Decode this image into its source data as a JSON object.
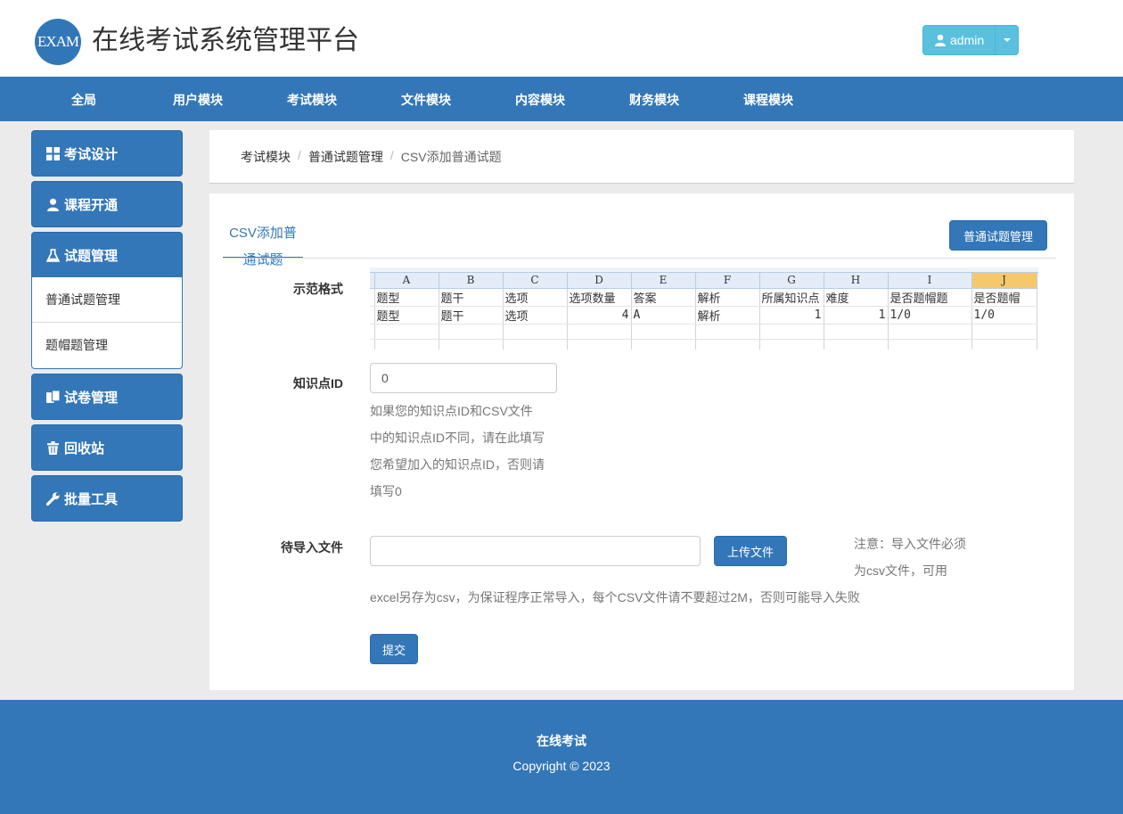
{
  "header": {
    "logo_text": "EXAM",
    "title": "在线考试系统管理平台",
    "user_label": "admin",
    "accent": "#3377b8"
  },
  "nav": {
    "items": [
      "全局",
      "用户模块",
      "考试模块",
      "文件模块",
      "内容模块",
      "财务模块",
      "课程模块"
    ]
  },
  "sidebar": {
    "items": [
      {
        "label": "考试设计",
        "icon": "grid-icon"
      },
      {
        "label": "课程开通",
        "icon": "user-icon"
      },
      {
        "label": "试题管理",
        "icon": "flask-icon"
      },
      {
        "label": "试卷管理",
        "icon": "copy-icon"
      },
      {
        "label": "回收站",
        "icon": "trash-icon"
      },
      {
        "label": "批量工具",
        "icon": "wrench-icon"
      }
    ],
    "subitems": [
      "普通试题管理",
      "题帽题管理"
    ]
  },
  "breadcrumb": {
    "items": [
      "考试模块",
      "普通试题管理",
      "CSV添加普通试题"
    ]
  },
  "main": {
    "tab_label": "CSV添加普通试题",
    "manage_button": "普通试题管理",
    "sample_label": "示范格式",
    "sheet": {
      "columns": [
        "A",
        "B",
        "C",
        "D",
        "E",
        "F",
        "G",
        "H",
        "I",
        "J"
      ],
      "rows": [
        [
          "题型",
          "题干",
          "选项",
          "选项数量",
          "答案",
          "解析",
          "所属知识点",
          "难度",
          "是否题帽题",
          "是否题帽"
        ],
        [
          "题型",
          "题干",
          "选项",
          "4",
          "A",
          "解析",
          "1",
          "1",
          "1/0",
          "1/0"
        ]
      ]
    },
    "knowledge_label": "知识点ID",
    "knowledge_value": "0",
    "knowledge_help": [
      "如果您的知识点ID和CSV文件",
      "中的知识点ID不同，请在此填写",
      "您希望加入的知识点ID，否则请",
      "填写0"
    ],
    "file_label": "待导入文件",
    "file_value": "",
    "upload_button": "上传文件",
    "file_note": [
      "注意：导入文件必须",
      "为csv文件，可用"
    ],
    "file_note_2": "excel另存为csv，为保证程序正常导入，每个CSV文件请不要超过2M，否则可能导入失败",
    "submit_button": "提交"
  },
  "footer": {
    "line1": "在线考试",
    "line2": "Copyright © 2023"
  }
}
